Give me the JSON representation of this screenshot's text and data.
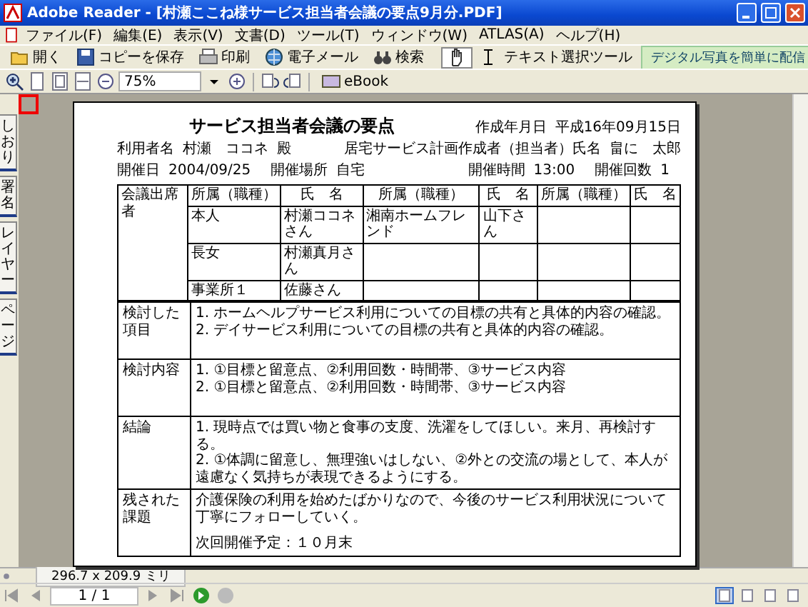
{
  "window": {
    "title": "Adobe Reader - [村瀬ここね様サービス担当者会議の要点9月分.PDF]"
  },
  "menu": [
    {
      "label": "ファイル(F)"
    },
    {
      "label": "編集(E)"
    },
    {
      "label": "表示(V)"
    },
    {
      "label": "文書(D)"
    },
    {
      "label": "ツール(T)"
    },
    {
      "label": "ウィンドウ(W)"
    },
    {
      "label": "ATLAS(A)"
    },
    {
      "label": "ヘルプ(H)"
    }
  ],
  "toolbar": [
    {
      "kind": "folder",
      "label": "開く"
    },
    {
      "kind": "disk",
      "label": "コピーを保存"
    },
    {
      "kind": "printer",
      "label": "印刷"
    },
    {
      "kind": "globe",
      "label": "電子メール"
    },
    {
      "kind": "binoculars",
      "label": "検索"
    }
  ],
  "tools": [
    {
      "kind": "hand",
      "selected": true
    },
    {
      "kind": "text",
      "label": "テキスト選択ツール",
      "selected": false
    }
  ],
  "promo": "デジタル写真を簡単に配信",
  "zoom": {
    "value": "75%"
  },
  "ebook": "eBook",
  "side_tabs": [
    {
      "label": "しおり"
    },
    {
      "label": "署名"
    },
    {
      "label": "レイヤー"
    },
    {
      "label": "ページ"
    }
  ],
  "document": {
    "title": "サービス担当者会議の要点",
    "created_label": "作成年月日",
    "created": "平成16年09月15日",
    "user_label": "利用者名",
    "user": "村瀬　ココネ",
    "honorific": "殿",
    "planner_label": "居宅サービス計画作成者（担当者）氏名",
    "planner": "畠に　太郎",
    "meeting": [
      {
        "label": "開催日",
        "value": "2004/09/25"
      },
      {
        "label": "開催場所",
        "value": "自宅"
      },
      {
        "label": "開催時間",
        "value": "13:00"
      },
      {
        "label": "開催回数",
        "value": "1"
      }
    ],
    "attendees": {
      "label": "会議出席者",
      "headers": [
        "所属（職種）",
        "氏　名",
        "所属（職種）",
        "氏　名",
        "所属（職種）",
        "氏　名"
      ],
      "rows": [
        {
          "cells": [
            "本人",
            "村瀬ココネさん",
            "湘南ホームフレンド",
            "山下さん"
          ]
        },
        {
          "cells": [
            "長女",
            "村瀬真月さん"
          ]
        },
        {
          "cells": [
            "事業所１",
            "佐藤さん"
          ]
        }
      ]
    },
    "sections": [
      {
        "label": "検討した項目",
        "lines": [
          "1. ホームヘルプサービス利用についての目標の共有と具体的内容の確認。",
          "2. デイサービス利用についての目標の共有と具体的内容の確認。"
        ]
      },
      {
        "label": "検討内容",
        "lines": [
          "1. ①目標と留意点、②利用回数・時間帯、③サービス内容",
          "2. ①目標と留意点、②利用回数・時間帯、③サービス内容"
        ]
      },
      {
        "label": "結論",
        "lines": [
          "1. 現時点では買い物と食事の支度、洗濯をしてほしい。来月、再検討する。",
          "2. ①体調に留意し、無理強いはしない、②外との交流の場として、本人が遠慮なく気持ちが表現できるようにする。"
        ]
      },
      {
        "label": "残された課題",
        "lines": [
          "介護保険の利用を始めたばかりなので、今後のサービス利用状況について丁寧にフォローしていく。",
          "次回開催予定：１０月末"
        ]
      }
    ]
  },
  "status": {
    "page_size": "296.7 x 209.9 ミリ",
    "page_number": "1 / 1"
  },
  "view_modes": [
    {
      "selected": true
    },
    {
      "selected": false
    },
    {
      "selected": false
    },
    {
      "selected": false
    }
  ]
}
